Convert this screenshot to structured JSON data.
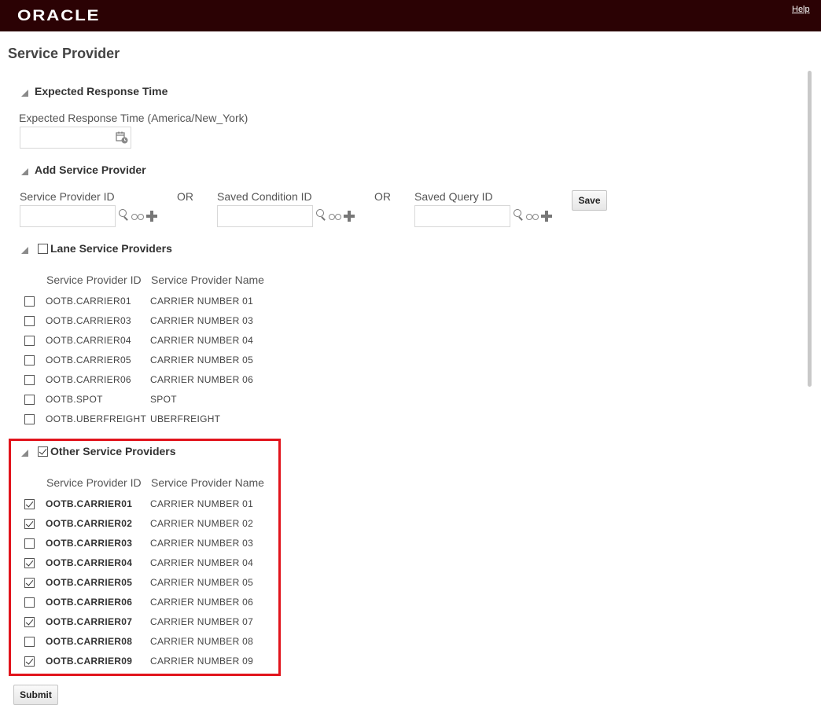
{
  "header": {
    "logo": "ORACLE",
    "help": "Help"
  },
  "page_title": "Service Provider",
  "expected_response": {
    "section_title": "Expected Response Time",
    "field_label": "Expected Response Time (America/New_York)",
    "field_value": ""
  },
  "add_provider": {
    "section_title": "Add Service Provider",
    "sp_id_label": "Service Provider ID",
    "or_label": "OR",
    "saved_condition_label": "Saved Condition ID",
    "saved_query_label": "Saved Query ID",
    "save_button": "Save"
  },
  "lane_providers": {
    "section_title": "Lane Service Providers",
    "checked": false,
    "col_id": "Service Provider ID",
    "col_name": "Service Provider Name",
    "rows": [
      {
        "id": "OOTB.CARRIER01",
        "name": "CARRIER NUMBER 01",
        "checked": false
      },
      {
        "id": "OOTB.CARRIER03",
        "name": "CARRIER NUMBER 03",
        "checked": false
      },
      {
        "id": "OOTB.CARRIER04",
        "name": "CARRIER NUMBER 04",
        "checked": false
      },
      {
        "id": "OOTB.CARRIER05",
        "name": "CARRIER NUMBER 05",
        "checked": false
      },
      {
        "id": "OOTB.CARRIER06",
        "name": "CARRIER NUMBER 06",
        "checked": false
      },
      {
        "id": "OOTB.SPOT",
        "name": "SPOT",
        "checked": false
      },
      {
        "id": "OOTB.UBERFREIGHT",
        "name": "UBERFREIGHT",
        "checked": false
      }
    ]
  },
  "other_providers": {
    "section_title": "Other Service Providers",
    "checked": true,
    "col_id": "Service Provider ID",
    "col_name": "Service Provider Name",
    "rows": [
      {
        "id": "OOTB.CARRIER01",
        "name": "CARRIER NUMBER 01",
        "checked": true
      },
      {
        "id": "OOTB.CARRIER02",
        "name": "CARRIER NUMBER 02",
        "checked": true
      },
      {
        "id": "OOTB.CARRIER03",
        "name": "CARRIER NUMBER 03",
        "checked": false
      },
      {
        "id": "OOTB.CARRIER04",
        "name": "CARRIER NUMBER 04",
        "checked": true
      },
      {
        "id": "OOTB.CARRIER05",
        "name": "CARRIER NUMBER 05",
        "checked": true
      },
      {
        "id": "OOTB.CARRIER06",
        "name": "CARRIER NUMBER 06",
        "checked": false
      },
      {
        "id": "OOTB.CARRIER07",
        "name": "CARRIER NUMBER 07",
        "checked": true
      },
      {
        "id": "OOTB.CARRIER08",
        "name": "CARRIER NUMBER 08",
        "checked": false
      },
      {
        "id": "OOTB.CARRIER09",
        "name": "CARRIER NUMBER 09",
        "checked": true
      }
    ]
  },
  "submit_button": "Submit",
  "colors": {
    "header_bg": "#2b0204",
    "highlight": "#e1141c"
  }
}
